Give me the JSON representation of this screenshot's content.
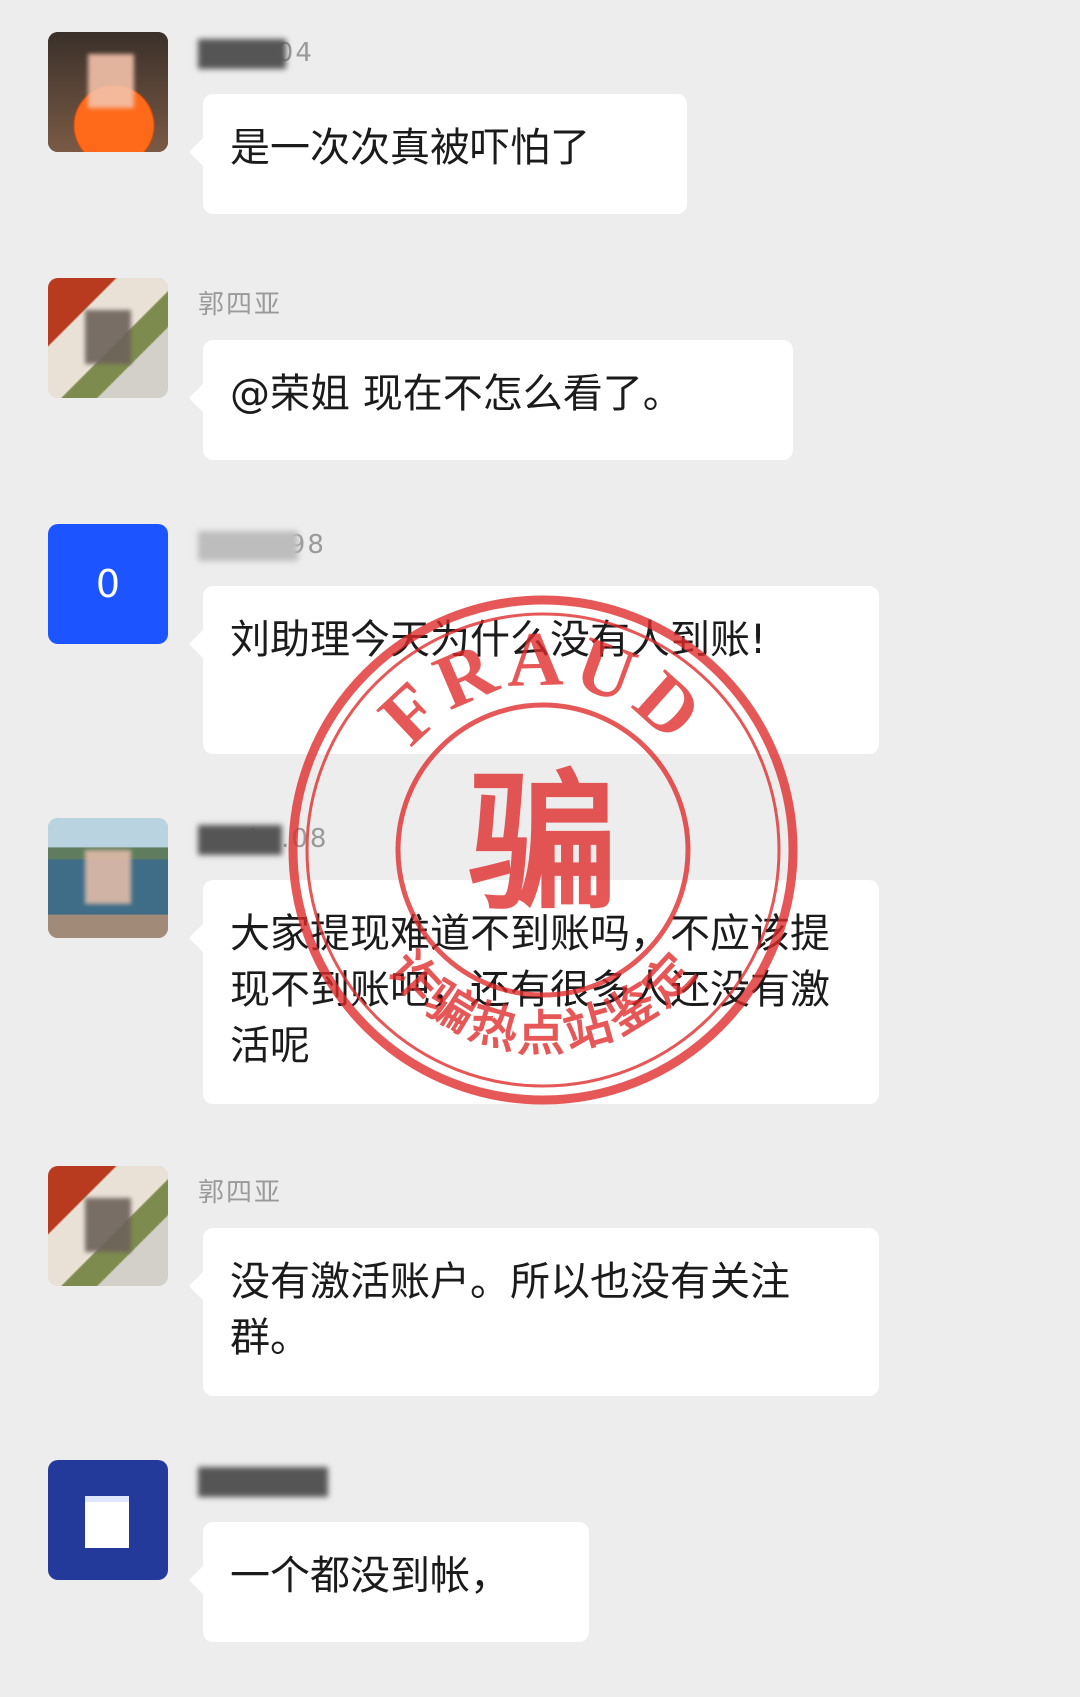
{
  "messages": [
    {
      "name": "...04",
      "text": "是一次次真被吓怕了",
      "avatar_icon": "persimmon-photo-avatar"
    },
    {
      "name": "郭四亚",
      "text": "@荣姐 现在不怎么看了。",
      "avatar_icon": "person-photo-avatar"
    },
    {
      "name": "...98",
      "text": "刘助理今天为什么没有人到账!",
      "avatar_icon": "letter-avatar",
      "avatar_letter": "0"
    },
    {
      "name": "4...08",
      "text": "大家提现难道不到账吗，不应该提现不到账吧，还有很多人还没有激活呢",
      "avatar_icon": "lake-photo-avatar"
    },
    {
      "name": "郭四亚",
      "text": "没有激活账户。所以也没有关注群。",
      "avatar_icon": "person-photo-avatar"
    },
    {
      "name": "...",
      "text": "一个都没到帐，",
      "avatar_icon": "calendar-avatar"
    }
  ],
  "stamp": {
    "top_text": "FRAUD",
    "center_char": "骗",
    "bottom_text": "诈骗热点站鉴定",
    "color": "#e02a2a"
  },
  "colors": {
    "background": "#ededed",
    "bubble": "#ffffff",
    "text": "#1b1b1b",
    "name": "#9a9a9a",
    "blue_avatar": "#1c55ff",
    "navy_avatar": "#243a9b"
  }
}
